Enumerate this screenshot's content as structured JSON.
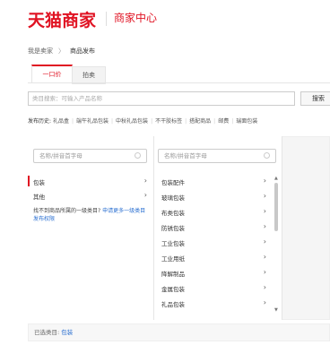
{
  "header": {
    "logo": "天猫商家",
    "subtitle": "商家中心"
  },
  "breadcrumb": {
    "home": "我是卖家",
    "sep": "〉",
    "current": "商品发布"
  },
  "tabs": [
    {
      "label": "一口价"
    },
    {
      "label": "拍卖"
    }
  ],
  "search": {
    "placeholder": "类目搜索：可输入产品名称",
    "button_label": "搜索"
  },
  "history": {
    "label": "发布历史:",
    "items": [
      "礼品盒",
      "端午礼品包装",
      "中秋礼品包装",
      "不干胶标签",
      "搭配商品",
      "邮费",
      "瑞面包装"
    ]
  },
  "col1": {
    "filter_placeholder": "名称/拼音首字母",
    "items": [
      {
        "label": "包装",
        "selected": true
      },
      {
        "label": "其他",
        "selected": false
      }
    ],
    "note_text": "找不到商品所属的一级类目? ",
    "note_link": "申请更多一级类目发布权限"
  },
  "col2": {
    "filter_placeholder": "名称/拼音首字母",
    "items": [
      "包装配件",
      "玻璃包装",
      "布类包装",
      "防锈包装",
      "工业包装",
      "工业用纸",
      "降解制品",
      "金属包装",
      "礼品包装"
    ]
  },
  "scroll": {
    "up": "▲",
    "down": "▼"
  },
  "footer": {
    "label": "已选类目: ",
    "value": "包装"
  },
  "colors": {
    "accent": "#e01222",
    "link": "#2a6fd1"
  },
  "icons": {
    "search": "search-icon",
    "chevron": "chevron-right-icon"
  }
}
